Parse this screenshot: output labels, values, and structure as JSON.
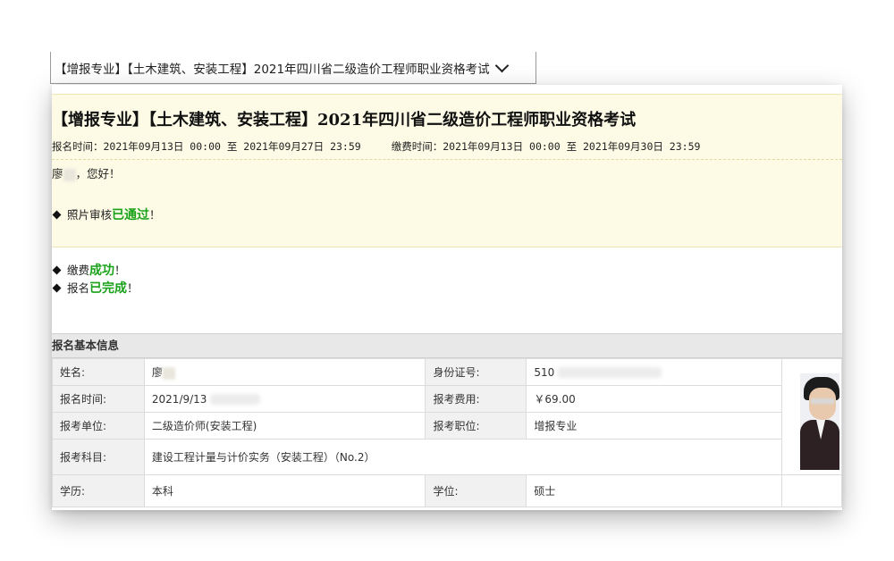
{
  "dropdown": {
    "selected": "【增报专业】【土木建筑、安装工程】2021年四川省二级造价工程师职业资格考试"
  },
  "exam": {
    "title": "【增报专业】【土木建筑、安装工程】2021年四川省二级造价工程师职业资格考试",
    "reg_time_label": "报名时间：",
    "reg_time_value": "2021年09月13日 00:00 至 2021年09月27日 23:59",
    "pay_time_label": "缴费时间：",
    "pay_time_value": "2021年09月13日 00:00 至 2021年09月30日 23:59"
  },
  "greeting": {
    "name": "廖",
    "suffix": "，您好！"
  },
  "statuses": [
    {
      "label": "照片审核",
      "result": "已通过",
      "end": "！"
    },
    {
      "label": "缴费",
      "result": "成功",
      "end": "！"
    },
    {
      "label": "报名",
      "result": "已完成",
      "end": "！"
    }
  ],
  "section_title": "报名基本信息",
  "info": {
    "name_label": "姓名:",
    "name_value": "廖",
    "id_label": "身份证号:",
    "id_value": "510",
    "reg_time_label": "报名时间:",
    "reg_time_value": "2021/9/13",
    "fee_label": "报考费用:",
    "fee_value": "￥69.00",
    "unit_label": "报考单位:",
    "unit_value": "二级造价师(安装工程)",
    "position_label": "报考职位:",
    "position_value": "增报专业",
    "subject_label": "报考科目:",
    "subject_value": "建设工程计量与计价实务（安装工程）（No.2）",
    "edu_label": "学历:",
    "edu_value": "本科",
    "degree_label": "学位:",
    "degree_value": "硕士"
  },
  "colors": {
    "success_green": "#1aa31a",
    "header_bg": "#fdfbe6",
    "section_bg": "#e8e8e8"
  }
}
